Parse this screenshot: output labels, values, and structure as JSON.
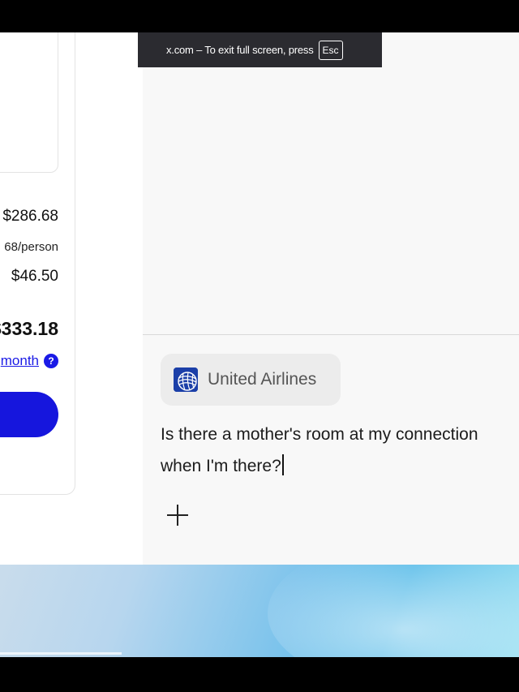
{
  "fullscreen_notice": {
    "text": "x.com – To exit full screen, press",
    "key": "Esc"
  },
  "checkout": {
    "subtotal": "$286.68",
    "per_person": "68/person",
    "taxes": "$46.50",
    "total": "$333.18",
    "monthly_link": "month",
    "help_icon": "?"
  },
  "chat": {
    "source_chip": {
      "label": "United Airlines",
      "icon": "united-airlines-globe-logo"
    },
    "message_lines": [
      "Is there a mother's room at my connection",
      "when I'm there?"
    ],
    "add_icon": "plus-icon"
  },
  "colors": {
    "accent_blue": "#1616dd",
    "link_blue": "#1a1ae6",
    "notice_bg": "#2b2b30",
    "chip_bg": "#ececec",
    "ua_logo_blue": "#1b3fa8"
  }
}
